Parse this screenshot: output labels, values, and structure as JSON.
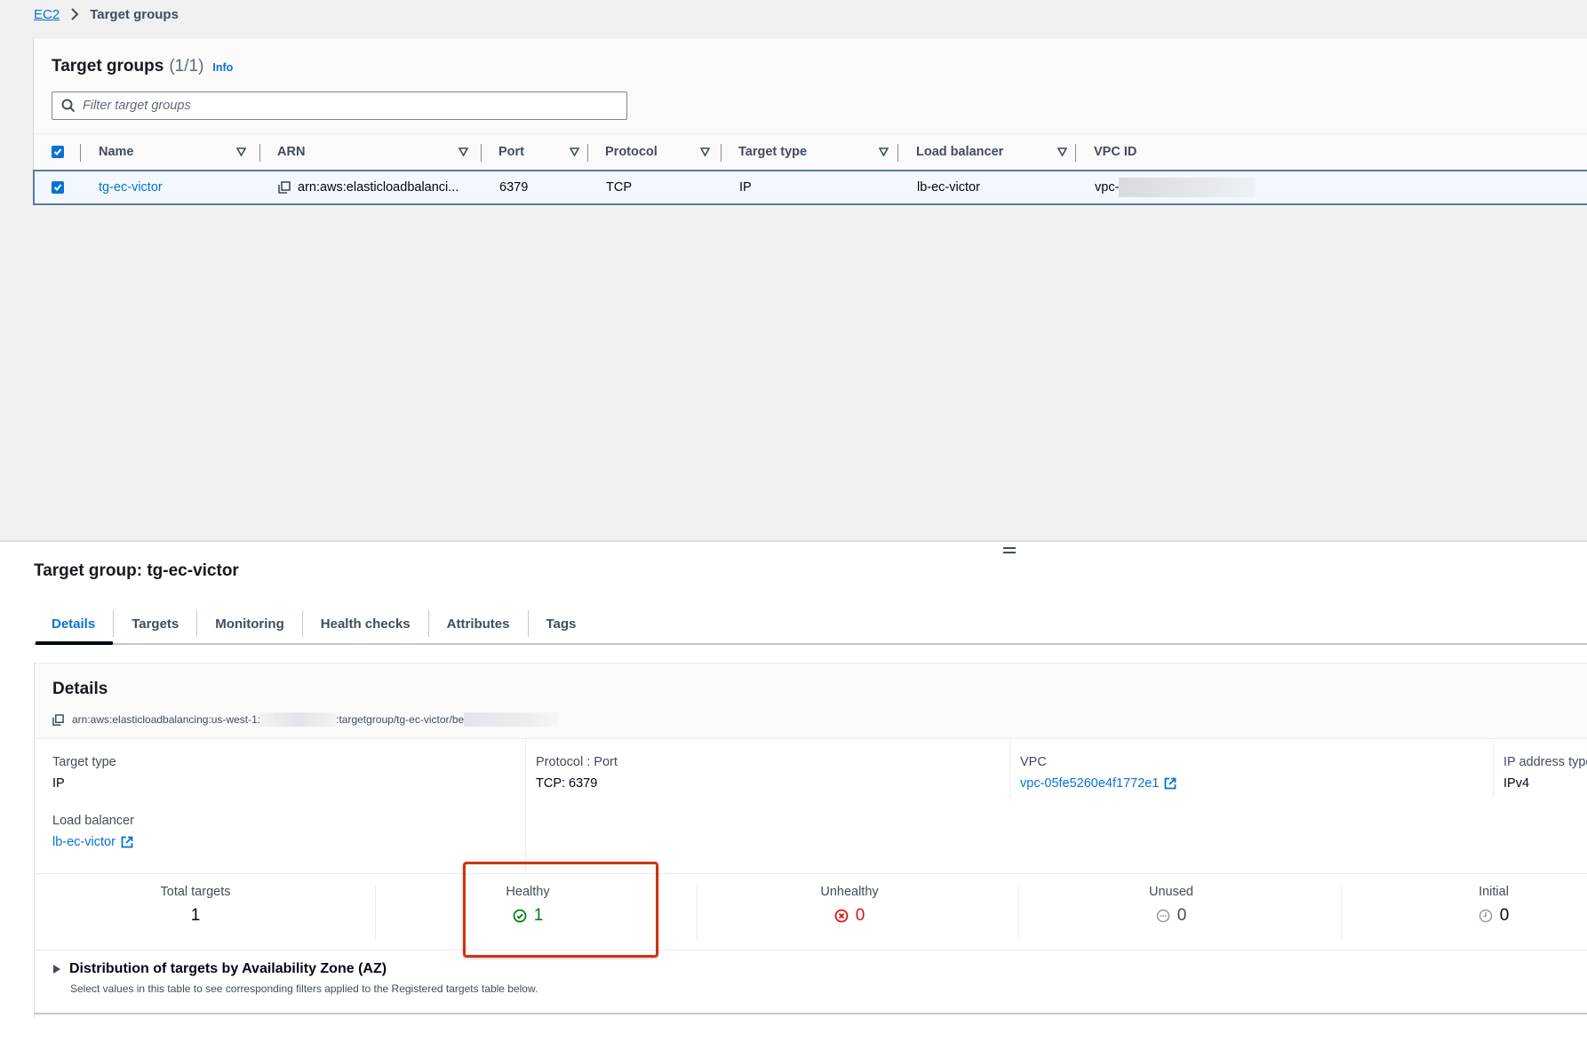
{
  "breadcrumb": {
    "items": [
      {
        "label": "EC2",
        "link": true
      },
      {
        "label": "Target groups",
        "link": false
      }
    ]
  },
  "target_groups": {
    "title": "Target groups",
    "count": "(1/1)",
    "info_label": "Info",
    "filter": {
      "placeholder": "Filter target groups",
      "value": ""
    },
    "columns": [
      "Name",
      "ARN",
      "Port",
      "Protocol",
      "Target type",
      "Load balancer",
      "VPC ID"
    ],
    "rows": [
      {
        "selected": true,
        "name": "tg-ec-victor",
        "arn": "arn:aws:elasticloadbalanci...",
        "port": "6379",
        "protocol": "TCP",
        "target_type": "IP",
        "load_balancer": "lb-ec-victor",
        "vpc_id": "vpc-"
      }
    ]
  },
  "detail_panel": {
    "title": "Target group: tg-ec-victor",
    "tabs": [
      {
        "label": "Details",
        "active": true
      },
      {
        "label": "Targets",
        "active": false
      },
      {
        "label": "Monitoring",
        "active": false
      },
      {
        "label": "Health checks",
        "active": false
      },
      {
        "label": "Attributes",
        "active": false
      },
      {
        "label": "Tags",
        "active": false
      }
    ],
    "details": {
      "title": "Details",
      "arn_prefix": "arn:aws:elasticloadbalancing:us-west-1:",
      "arn_middle": ":targetgroup/tg-ec-victor/be",
      "target_type_label": "Target type",
      "target_type_value": "IP",
      "protocol_port_label": "Protocol : Port",
      "protocol_port_value": "TCP: 6379",
      "vpc_label": "VPC",
      "vpc_value": "vpc-05fe5260e4f1772e1",
      "ip_address_type_label": "IP address type",
      "ip_address_type_value": "IPv4",
      "load_balancer_label": "Load balancer",
      "load_balancer_value": "lb-ec-victor"
    },
    "counts": [
      {
        "label": "Total targets",
        "value": "1",
        "status": "none"
      },
      {
        "label": "Healthy",
        "value": "1",
        "status": "healthy"
      },
      {
        "label": "Unhealthy",
        "value": "0",
        "status": "unhealthy"
      },
      {
        "label": "Unused",
        "value": "0",
        "status": "unused"
      },
      {
        "label": "Initial",
        "value": "0",
        "status": "initial"
      }
    ],
    "distribution": {
      "title": "Distribution of targets by Availability Zone (AZ)",
      "description": "Select values in this table to see corresponding filters applied to the Registered targets table below."
    }
  },
  "colors": {
    "link": "#0972d3",
    "healthy": "#037f0c",
    "unhealthy": "#d91515",
    "neutral": "#8d99a8",
    "highlight_box": "#d13212"
  }
}
